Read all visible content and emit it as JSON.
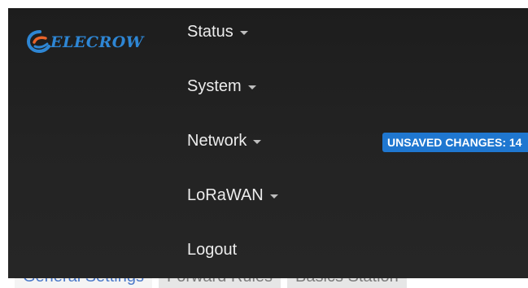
{
  "tabs": [
    {
      "label": "General Settings",
      "active": true
    },
    {
      "label": "Forward Rules",
      "active": false
    },
    {
      "label": "Basics Station",
      "active": false
    }
  ],
  "logo": {
    "text": "ELECROW",
    "icon": "elecrow-swirl-logo-icon"
  },
  "menu": {
    "items": [
      {
        "label": "Status",
        "has_dropdown": true
      },
      {
        "label": "System",
        "has_dropdown": true
      },
      {
        "label": "Network",
        "has_dropdown": true
      },
      {
        "label": "LoRaWAN",
        "has_dropdown": true
      },
      {
        "label": "Logout",
        "has_dropdown": false
      }
    ]
  },
  "badge": {
    "text": "UNSAVED CHANGES: 14"
  },
  "colors": {
    "panel": "#222222",
    "menu_text": "#ececec",
    "badge": "#1f77d0",
    "logo": "#2e86d4",
    "logo_accent": "#e8632a"
  }
}
